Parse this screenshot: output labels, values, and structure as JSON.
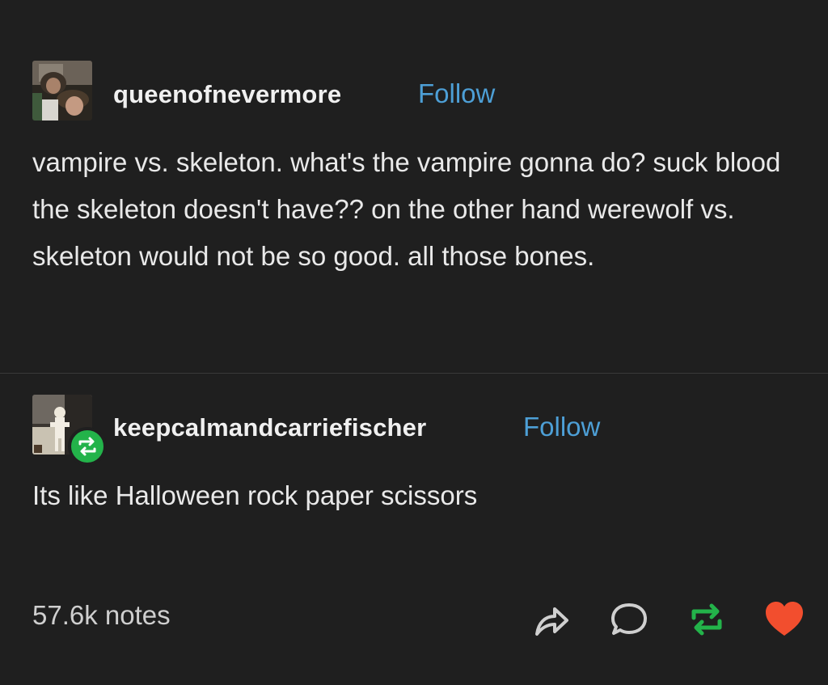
{
  "original_post": {
    "username": "queenofnevermore",
    "follow_label": "Follow",
    "text": "vampire vs. skeleton. what's the vampire gonna do? suck blood the skeleton doesn't have?? on the other hand werewolf vs. skeleton would not be so good. all those bones."
  },
  "reply": {
    "username": "keepcalmandcarriefischer",
    "follow_label": "Follow",
    "text": "Its like Halloween rock paper scissors"
  },
  "footer": {
    "notes": "57.6k notes",
    "actions": [
      "share-icon",
      "comment-icon",
      "reblog-icon",
      "heart-icon"
    ]
  },
  "colors": {
    "background": "#1f1f1f",
    "follow": "#4d9fd6",
    "reblog": "#23b34a",
    "heart": "#f24e2e"
  }
}
